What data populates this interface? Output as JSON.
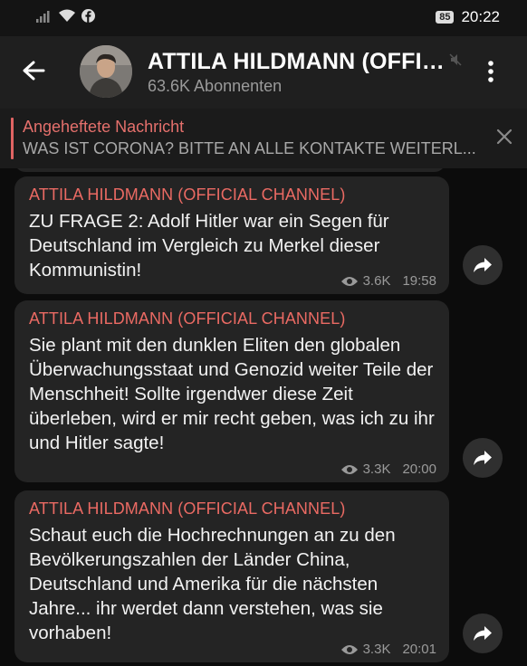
{
  "status_bar": {
    "battery": "85",
    "time": "20:22"
  },
  "header": {
    "channel_name": "ATTILA HILDMANN (OFFICI…",
    "subscribers": "63.6K Abonnenten",
    "icons": {
      "back": "arrow-left-icon",
      "mute": "muted-icon",
      "menu": "more-vertical-icon"
    }
  },
  "pinned": {
    "title": "Angeheftete Nachricht",
    "text": "WAS IST CORONA? BITTE AN ALLE KONTAKTE WEITERL..."
  },
  "messages": [
    {
      "author": "ATTILA HILDMANN (OFFICIAL CHANNEL)",
      "text": "ZU FRAGE 2: Adolf Hitler war ein Segen für Deutschland im Vergleich zu Merkel dieser Kommunistin!",
      "views": "3.6K",
      "time": "19:58"
    },
    {
      "author": "ATTILA HILDMANN (OFFICIAL CHANNEL)",
      "text": "Sie plant mit den dunklen Eliten den globalen Überwachungsstaat und Genozid weiter Teile der Menschheit! Sollte irgendwer diese Zeit überleben, wird er mir recht geben, was ich zu ihr und Hitler sagte!",
      "views": "3.3K",
      "time": "20:00"
    },
    {
      "author": "ATTILA HILDMANN (OFFICIAL CHANNEL)",
      "text": "Schaut euch die Hochrechnungen an zu den Bevölkerungszahlen der Länder China, Deutschland und Amerika für die nächsten Jahre... ihr werdet dann verstehen, was sie vorhaben!",
      "views": "3.3K",
      "time": "20:01"
    }
  ],
  "colors": {
    "accent": "#e5706c",
    "bubble": "#242424",
    "header": "#1f1f1f"
  }
}
